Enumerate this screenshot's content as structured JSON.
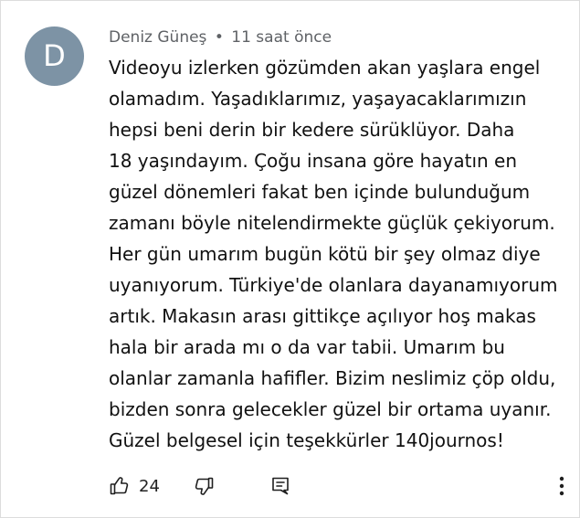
{
  "comment": {
    "avatar_letter": "D",
    "author": "Deniz Güneş",
    "separator": "•",
    "timestamp": "11 saat önce",
    "text": "Videoyu izlerken gözümden akan yaşlara engel\nolamadım. Yaşadıklarımız, yaşayacaklarımızın\nhepsi beni derin bir kedere sürüklüyor. Daha\n18 yaşındayım. Çoğu insana göre hayatın en\ngüzel dönemleri fakat ben içinde bulunduğum\nzamanı böyle nitelendirmekte güçlük çekiyorum.\nHer gün umarım bugün kötü bir şey olmaz diye\nuyanıyorum. Türkiye'de olanlara dayanamıyorum\nartık. Makasın arası gittikçe açılıyor hoş makas\nhala bir arada mı o da var tabii. Umarım bu\nolanlar zamanla hafifler. Bizim neslimiz çöp oldu,\nbizden sonra gelecekler güzel bir ortama uyanır.\nGüzel belgesel için teşekkürler 140journos!",
    "like_count": "24"
  },
  "icons": {
    "like": "thumbs-up-icon",
    "dislike": "thumbs-down-icon",
    "reply": "reply-comment-icon",
    "more": "more-vertical-icon"
  },
  "colors": {
    "avatar_bg": "#7d93a5",
    "meta_text": "#5f6266",
    "body_text": "#111111"
  }
}
